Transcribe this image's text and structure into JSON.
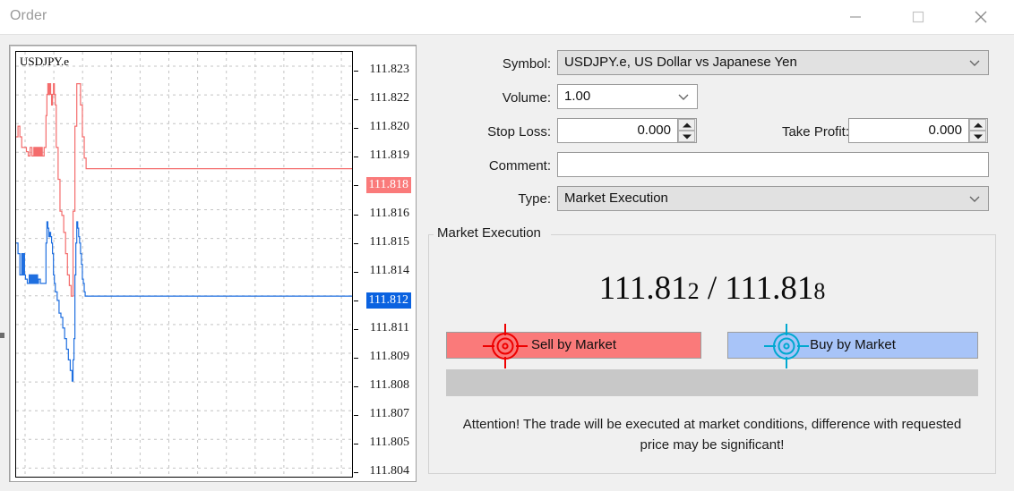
{
  "window": {
    "title": "Order",
    "controls": [
      {
        "name": "minimize",
        "glyph": "minimize-icon"
      },
      {
        "name": "maximize",
        "glyph": "maximize-icon"
      },
      {
        "name": "close",
        "glyph": "close-icon"
      }
    ]
  },
  "chart": {
    "symbol_label": "USDJPY.e",
    "price_labels": [
      "111.823",
      "111.822",
      "111.820",
      "111.819",
      "111.818",
      "111.816",
      "111.815",
      "111.814",
      "111.812",
      "111.811",
      "111.809",
      "111.808",
      "111.807",
      "111.805",
      "111.804"
    ],
    "ask_marker": "111.818",
    "bid_marker": "111.812",
    "ask_color": "#fa7a7a",
    "bid_color": "#0a62e0"
  },
  "form": {
    "symbol": {
      "label": "Symbol:",
      "value": "USDJPY.e, US Dollar vs Japanese Yen"
    },
    "volume": {
      "label": "Volume:",
      "value": "1.00"
    },
    "stop_loss": {
      "label": "Stop Loss:",
      "value": "0.000"
    },
    "take_profit": {
      "label": "Take Profit:",
      "value": "0.000"
    },
    "comment": {
      "label": "Comment:",
      "value": "",
      "placeholder": ""
    },
    "type": {
      "label": "Type:",
      "value": "Market Execution"
    }
  },
  "execution": {
    "group_legend": "Market Execution",
    "bid": {
      "main": "111.81",
      "last": "2"
    },
    "separator": "/",
    "ask": {
      "main": "111.81",
      "last": "8"
    },
    "sell_button": "Sell by Market",
    "buy_button": "Buy by Market",
    "sell_color": "#fa7a7a",
    "buy_color": "#a8c4f8",
    "sell_icon": "crosshair-target-icon",
    "buy_icon": "crosshair-target-icon",
    "attention": "Attention! The trade will be executed at market conditions, difference with requested price may be significant!"
  },
  "chart_data": {
    "type": "line",
    "title": "USDJPY.e",
    "xlabel": "",
    "ylabel": "",
    "ylim": [
      111.8035,
      111.8235
    ],
    "grid": true,
    "legend": "none",
    "yticks": [
      111.823,
      111.822,
      111.82,
      111.819,
      111.818,
      111.816,
      111.815,
      111.814,
      111.812,
      111.811,
      111.809,
      111.808,
      111.807,
      111.805,
      111.804
    ],
    "series": [
      {
        "name": "Ask",
        "color": "#f46c6c",
        "values": [
          111.8195,
          111.8195,
          111.82,
          111.82,
          111.8195,
          111.8195,
          111.819,
          111.819,
          111.819,
          111.819,
          111.819,
          111.8188,
          111.8188,
          111.8186,
          111.8186,
          111.819,
          111.819,
          111.8186,
          111.8186,
          111.819,
          111.8186,
          111.819,
          111.8186,
          111.819,
          111.8186,
          111.819,
          111.8186,
          111.819,
          111.8186,
          111.8186,
          111.819,
          111.819,
          111.8205,
          111.8215,
          111.822,
          111.8215,
          111.822,
          111.8215,
          111.821,
          111.8215,
          111.822,
          111.8215,
          111.821,
          111.819,
          111.819,
          111.8175,
          111.8175,
          111.816,
          111.816,
          111.8158,
          111.8158,
          111.815,
          111.815,
          111.814,
          111.814,
          111.813,
          111.813,
          111.8125,
          111.8125,
          111.812,
          111.812,
          111.816,
          111.816,
          111.82,
          111.82,
          111.822,
          111.822,
          111.822,
          111.822,
          111.821,
          111.821,
          111.8195,
          111.8195,
          111.8185,
          111.8185,
          111.818,
          111.818,
          111.818,
          111.818,
          111.818,
          111.818,
          111.818,
          111.818,
          111.818,
          111.818,
          111.818,
          111.818,
          111.818,
          111.818,
          111.818,
          111.818,
          111.818,
          111.818,
          111.818,
          111.818,
          111.818,
          111.818,
          111.818,
          111.818,
          111.818
        ]
      },
      {
        "name": "Bid",
        "color": "#1f6fe0",
        "values": [
          111.8145,
          111.8145,
          111.814,
          111.814,
          111.813,
          111.813,
          111.814,
          111.813,
          111.814,
          111.813,
          111.8128,
          111.8128,
          111.8126,
          111.8126,
          111.813,
          111.8126,
          111.813,
          111.8126,
          111.813,
          111.8126,
          111.813,
          111.8126,
          111.813,
          111.8126,
          111.8128,
          111.8128,
          111.8126,
          111.8126,
          111.8126,
          111.8126,
          111.8126,
          111.8126,
          111.8145,
          111.8155,
          111.8152,
          111.8148,
          111.815,
          111.8148,
          111.8145,
          111.814,
          111.813,
          111.8126,
          111.8122,
          111.8122,
          111.8118,
          111.8118,
          111.8112,
          111.8112,
          111.811,
          111.811,
          111.8105,
          111.8105,
          111.81,
          111.81,
          111.8095,
          111.8095,
          111.809,
          111.809,
          111.8085,
          111.8085,
          111.808,
          111.809,
          111.81,
          111.813,
          111.8145,
          111.8155,
          111.8152,
          111.8148,
          111.8145,
          111.814,
          111.8135,
          111.8128,
          111.8126,
          111.8122,
          111.812,
          111.812,
          111.812,
          111.812,
          111.812,
          111.812,
          111.812,
          111.812,
          111.812,
          111.812,
          111.812,
          111.812,
          111.812,
          111.812,
          111.812,
          111.812,
          111.812,
          111.812,
          111.812,
          111.812,
          111.812,
          111.812,
          111.812,
          111.812,
          111.812,
          111.812
        ]
      }
    ]
  }
}
